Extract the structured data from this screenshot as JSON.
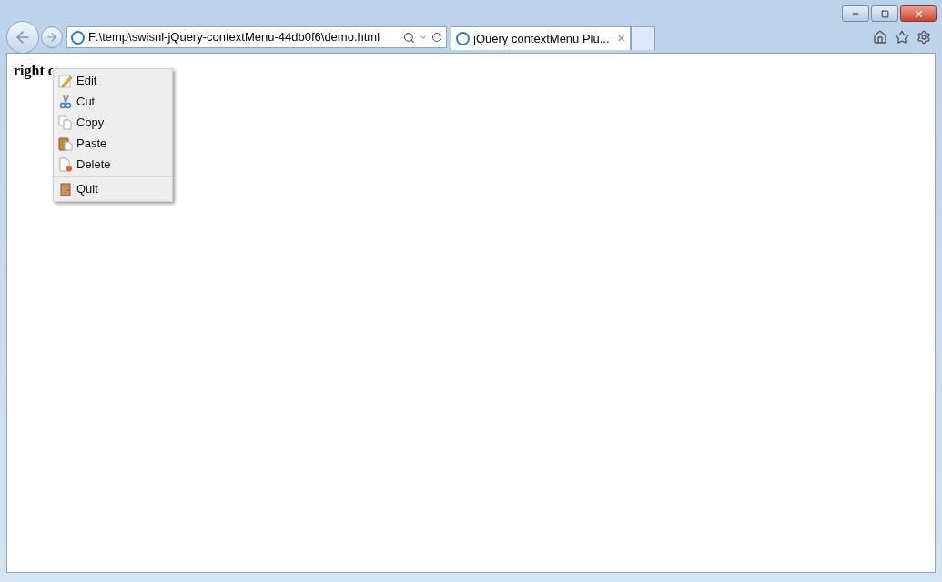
{
  "address_bar": {
    "url": "F:\\temp\\swisnl-jQuery-contextMenu-44db0f6\\demo.html"
  },
  "tabs": [
    {
      "label": "jQuery contextMenu Plu...",
      "selected": true,
      "close": "×"
    }
  ],
  "page": {
    "heading": "right c"
  },
  "context_menu": {
    "items": [
      {
        "label": "Edit",
        "kind": "edit",
        "separator_before": false
      },
      {
        "label": "Cut",
        "kind": "cut",
        "separator_before": false
      },
      {
        "label": "Copy",
        "kind": "copy",
        "separator_before": false
      },
      {
        "label": "Paste",
        "kind": "paste",
        "separator_before": false
      },
      {
        "label": "Delete",
        "kind": "delete",
        "separator_before": false
      },
      {
        "label": "Quit",
        "kind": "quit",
        "separator_before": true
      }
    ]
  }
}
